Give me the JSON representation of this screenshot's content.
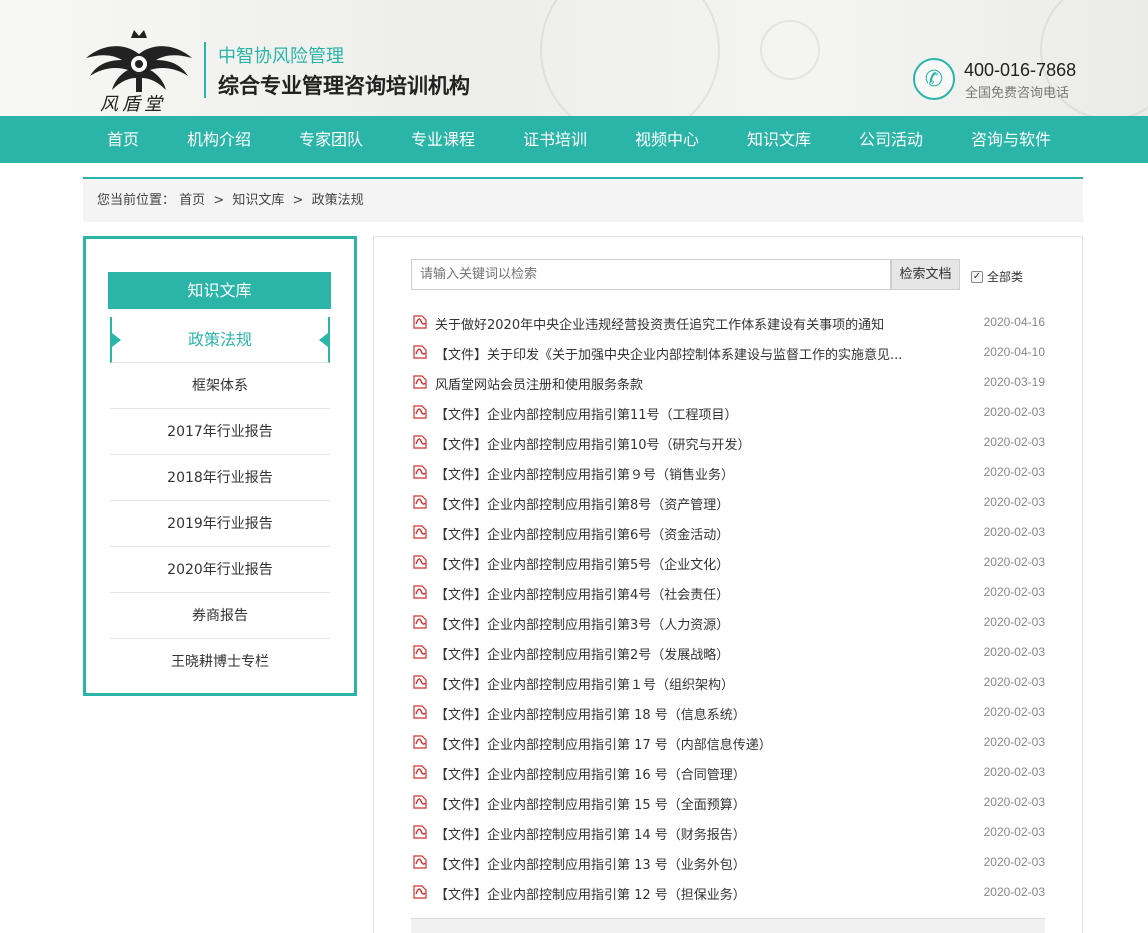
{
  "header": {
    "logo_text": "风盾堂",
    "brand_line1": "中智协风险管理",
    "brand_line2": "综合专业管理咨询培训机构",
    "phone_number": "400-016-7868",
    "phone_desc": "全国免费咨询电话",
    "phone_icon": "phone-icon"
  },
  "nav": {
    "items": [
      {
        "label": "首页"
      },
      {
        "label": "机构介绍"
      },
      {
        "label": "专家团队"
      },
      {
        "label": "专业课程"
      },
      {
        "label": "证书培训"
      },
      {
        "label": "视频中心"
      },
      {
        "label": "知识文库"
      },
      {
        "label": "公司活动"
      },
      {
        "label": "咨询与软件"
      }
    ]
  },
  "breadcrumb": {
    "prefix": "您当前位置：",
    "items": [
      "首页",
      "知识文库",
      "政策法规"
    ],
    "separator": ">"
  },
  "sidebar": {
    "title": "知识文库",
    "active": "政策法规",
    "items": [
      {
        "label": "框架体系"
      },
      {
        "label": "2017年行业报告"
      },
      {
        "label": "2018年行业报告"
      },
      {
        "label": "2019年行业报告"
      },
      {
        "label": "2020年行业报告"
      },
      {
        "label": "券商报告"
      },
      {
        "label": "王晓耕博士专栏"
      }
    ]
  },
  "search": {
    "placeholder": "请输入关键词以检索",
    "button_label": "检索文档",
    "checkbox_label": "全部类",
    "checkbox_checked": true
  },
  "documents": [
    {
      "title": "关于做好2020年中央企业违规经营投资责任追究工作体系建设有关事项的通知",
      "date": "2020-04-16"
    },
    {
      "title": "【文件】关于印发《关于加强中央企业内部控制体系建设与监督工作的实施意见...",
      "date": "2020-04-10"
    },
    {
      "title": "风盾堂网站会员注册和使用服务条款",
      "date": "2020-03-19"
    },
    {
      "title": "【文件】企业内部控制应用指引第11号（工程项目）",
      "date": "2020-02-03"
    },
    {
      "title": "【文件】企业内部控制应用指引第10号（研究与开发）",
      "date": "2020-02-03"
    },
    {
      "title": "【文件】企业内部控制应用指引第９号（销售业务）",
      "date": "2020-02-03"
    },
    {
      "title": "【文件】企业内部控制应用指引第8号（资产管理）",
      "date": "2020-02-03"
    },
    {
      "title": "【文件】企业内部控制应用指引第6号（资金活动）",
      "date": "2020-02-03"
    },
    {
      "title": "【文件】企业内部控制应用指引第5号（企业文化）",
      "date": "2020-02-03"
    },
    {
      "title": "【文件】企业内部控制应用指引第4号（社会责任）",
      "date": "2020-02-03"
    },
    {
      "title": "【文件】企业内部控制应用指引第3号（人力资源）",
      "date": "2020-02-03"
    },
    {
      "title": "【文件】企业内部控制应用指引第2号（发展战略）",
      "date": "2020-02-03"
    },
    {
      "title": "【文件】企业内部控制应用指引第１号（组织架构）",
      "date": "2020-02-03"
    },
    {
      "title": "【文件】企业内部控制应用指引第 18 号（信息系统）",
      "date": "2020-02-03"
    },
    {
      "title": "【文件】企业内部控制应用指引第 17 号（内部信息传递）",
      "date": "2020-02-03"
    },
    {
      "title": "【文件】企业内部控制应用指引第 16 号（合同管理）",
      "date": "2020-02-03"
    },
    {
      "title": "【文件】企业内部控制应用指引第 15 号（全面预算）",
      "date": "2020-02-03"
    },
    {
      "title": "【文件】企业内部控制应用指引第 14 号（财务报告）",
      "date": "2020-02-03"
    },
    {
      "title": "【文件】企业内部控制应用指引第 13 号（业务外包）",
      "date": "2020-02-03"
    },
    {
      "title": "【文件】企业内部控制应用指引第 12 号（担保业务）",
      "date": "2020-02-03"
    }
  ],
  "colors": {
    "accent": "#2bb5a8",
    "pdf_red": "#d0302f"
  }
}
